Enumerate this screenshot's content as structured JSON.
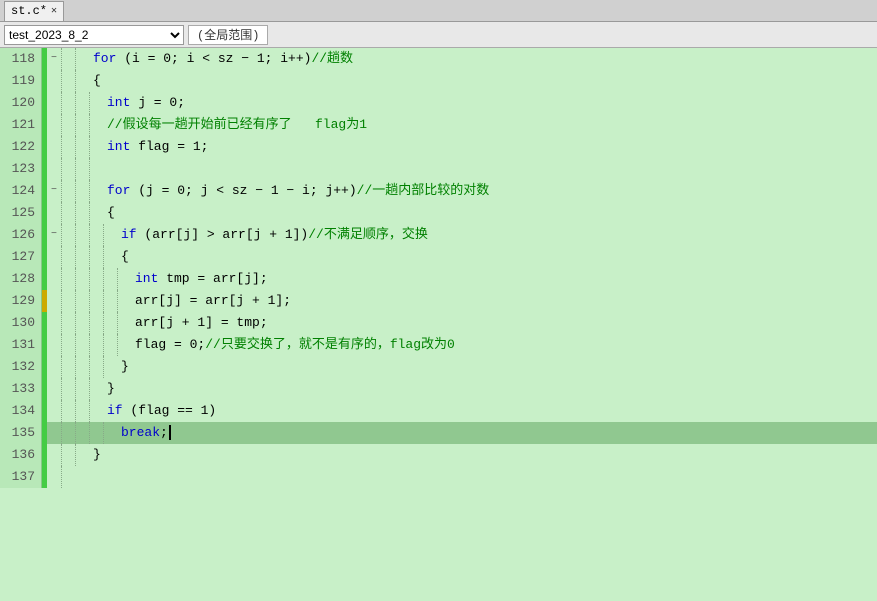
{
  "titleBar": {
    "tab": "st.c*",
    "closeBtn": "✕"
  },
  "toolbar": {
    "functionName": "test_2023_8_2",
    "scope": "(全局范围)"
  },
  "lines": [
    {
      "num": 118,
      "leftBar": "green",
      "fold": "−",
      "indents": 2,
      "tokens": [
        {
          "type": "kw",
          "text": "for"
        },
        {
          "type": "plain",
          "text": " (i = 0; i < sz − 1; i++)"
        },
        {
          "type": "cmt",
          "text": "//趟数"
        }
      ]
    },
    {
      "num": 119,
      "leftBar": "green",
      "fold": "",
      "indents": 2,
      "tokens": [
        {
          "type": "plain",
          "text": "{"
        }
      ]
    },
    {
      "num": 120,
      "leftBar": "green",
      "fold": "",
      "indents": 3,
      "tokens": [
        {
          "type": "kw",
          "text": "int"
        },
        {
          "type": "plain",
          "text": " j = 0;"
        }
      ]
    },
    {
      "num": 121,
      "leftBar": "green",
      "fold": "",
      "indents": 3,
      "tokens": [
        {
          "type": "cmt",
          "text": "//假设每一趟开始前已经有序了   flag为1"
        }
      ]
    },
    {
      "num": 122,
      "leftBar": "green",
      "fold": "",
      "indents": 3,
      "tokens": [
        {
          "type": "kw",
          "text": "int"
        },
        {
          "type": "plain",
          "text": " flag = 1;"
        }
      ]
    },
    {
      "num": 123,
      "leftBar": "green",
      "fold": "",
      "indents": 3,
      "tokens": []
    },
    {
      "num": 124,
      "leftBar": "green",
      "fold": "−",
      "indents": 3,
      "tokens": [
        {
          "type": "kw",
          "text": "for"
        },
        {
          "type": "plain",
          "text": " (j = 0; j < sz − 1 − i; j++)"
        },
        {
          "type": "cmt",
          "text": "//一趟内部比较的对数"
        }
      ]
    },
    {
      "num": 125,
      "leftBar": "green",
      "fold": "",
      "indents": 3,
      "tokens": [
        {
          "type": "plain",
          "text": "{"
        }
      ]
    },
    {
      "num": 126,
      "leftBar": "green",
      "fold": "−",
      "indents": 4,
      "tokens": [
        {
          "type": "kw",
          "text": "if"
        },
        {
          "type": "plain",
          "text": " (arr[j] > arr[j + 1])"
        },
        {
          "type": "cmt",
          "text": "//不满足顺序，交换"
        }
      ]
    },
    {
      "num": 127,
      "leftBar": "green",
      "fold": "",
      "indents": 4,
      "tokens": [
        {
          "type": "plain",
          "text": "{"
        }
      ]
    },
    {
      "num": 128,
      "leftBar": "green",
      "fold": "",
      "indents": 5,
      "tokens": [
        {
          "type": "kw",
          "text": "int"
        },
        {
          "type": "plain",
          "text": " tmp = arr[j];"
        }
      ]
    },
    {
      "num": 129,
      "leftBar": "yellow",
      "fold": "",
      "indents": 5,
      "tokens": [
        {
          "type": "plain",
          "text": "arr[j] = arr[j + 1];"
        }
      ]
    },
    {
      "num": 130,
      "leftBar": "green",
      "fold": "",
      "indents": 5,
      "tokens": [
        {
          "type": "plain",
          "text": "arr[j + 1] = tmp;"
        }
      ]
    },
    {
      "num": 131,
      "leftBar": "green",
      "fold": "",
      "indents": 5,
      "tokens": [
        {
          "type": "plain",
          "text": "flag = 0;"
        },
        {
          "type": "cmt",
          "text": "//只要交换了，就不是有序的，flag改为0"
        }
      ]
    },
    {
      "num": 132,
      "leftBar": "green",
      "fold": "",
      "indents": 4,
      "tokens": [
        {
          "type": "plain",
          "text": "}"
        }
      ]
    },
    {
      "num": 133,
      "leftBar": "green",
      "fold": "",
      "indents": 3,
      "tokens": [
        {
          "type": "plain",
          "text": "}"
        }
      ]
    },
    {
      "num": 134,
      "leftBar": "green",
      "fold": "",
      "indents": 3,
      "tokens": [
        {
          "type": "kw",
          "text": "if"
        },
        {
          "type": "plain",
          "text": " (flag == 1)"
        }
      ]
    },
    {
      "num": 135,
      "leftBar": "green",
      "fold": "",
      "indents": 4,
      "current": true,
      "tokens": [
        {
          "type": "kw",
          "text": "break"
        },
        {
          "type": "plain",
          "text": ";"
        }
      ]
    },
    {
      "num": 136,
      "leftBar": "green",
      "fold": "",
      "indents": 2,
      "tokens": [
        {
          "type": "plain",
          "text": "}"
        }
      ]
    },
    {
      "num": 137,
      "leftBar": "green",
      "fold": "",
      "indents": 1,
      "tokens": []
    }
  ]
}
